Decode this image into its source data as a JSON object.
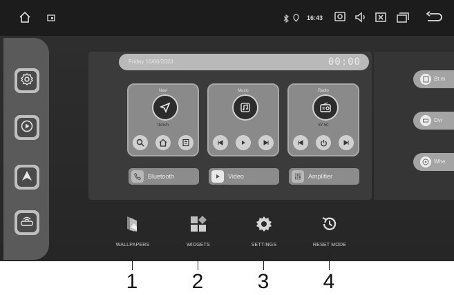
{
  "status_bar": {
    "time": "16:43",
    "icons": [
      "home-icon",
      "media-icon",
      "bluetooth-icon",
      "location-icon",
      "screenshot-icon",
      "volume-icon",
      "close-app-icon",
      "windows-icon",
      "back-icon"
    ]
  },
  "dock": {
    "items": [
      "settings-icon",
      "play-icon",
      "navigation-icon",
      "router-icon"
    ]
  },
  "preview": {
    "date": "Friday 16/06/2023",
    "clock": "00:00",
    "cards": [
      {
        "title": "Navi",
        "value": "0km/h",
        "icon": "navigation-arrow-icon",
        "controls": [
          "search-icon",
          "home-icon",
          "list-icon"
        ]
      },
      {
        "title": "Music",
        "value": "",
        "icon": "music-note-icon",
        "controls": [
          "previous-icon",
          "play-icon",
          "next-icon"
        ]
      },
      {
        "title": "Radio",
        "value": "87.50",
        "icon": "radio-icon",
        "controls": [
          "previous-icon",
          "power-icon",
          "next-icon"
        ]
      }
    ],
    "pills": [
      {
        "label": "Bluetooth",
        "icon": "phone-icon"
      },
      {
        "label": "Video",
        "icon": "play-icon"
      },
      {
        "label": "Amplifier",
        "icon": "equalizer-icon"
      }
    ],
    "right_items": [
      {
        "label": "Bt m",
        "icon": "file-icon"
      },
      {
        "label": "Dvr",
        "icon": "camera-icon"
      },
      {
        "label": "Whe",
        "icon": "steering-wheel-icon"
      }
    ]
  },
  "menu": {
    "items": [
      {
        "label": "WALLPAPERS",
        "icon": "wallpapers-icon"
      },
      {
        "label": "WIDGETS",
        "icon": "widgets-icon"
      },
      {
        "label": "SETTINGS",
        "icon": "settings-gear-icon"
      },
      {
        "label": "RESET MODE",
        "icon": "reset-icon"
      }
    ]
  },
  "callouts": [
    "1",
    "2",
    "3",
    "4"
  ]
}
